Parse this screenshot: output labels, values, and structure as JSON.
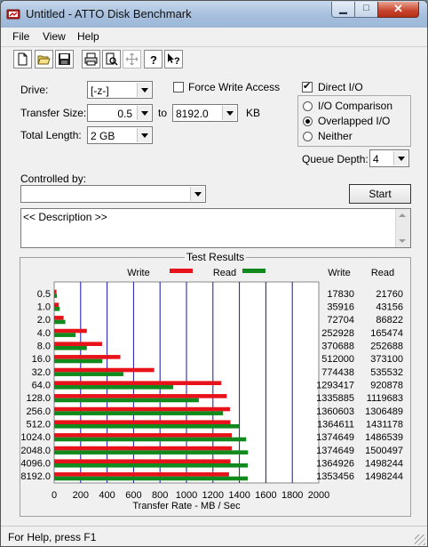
{
  "window": {
    "title": "Untitled - ATTO Disk Benchmark"
  },
  "menu": [
    "File",
    "View",
    "Help"
  ],
  "toolbar": [
    "new-file-icon",
    "open-folder-icon",
    "save-icon",
    "print-icon",
    "print-preview-icon",
    "move-icon",
    "help-icon",
    "context-help-icon"
  ],
  "form": {
    "drive_label": "Drive:",
    "drive_value": "[-z-]",
    "force_write_label": "Force Write Access",
    "force_write_checked": false,
    "direct_io_label": "Direct I/O",
    "direct_io_checked": true,
    "transfer_size_label": "Transfer Size:",
    "transfer_min": "0.5",
    "to_label": "to",
    "transfer_max": "8192.0",
    "kb_label": "KB",
    "total_length_label": "Total Length:",
    "total_length_value": "2 GB",
    "io_options": [
      "I/O Comparison",
      "Overlapped I/O",
      "Neither"
    ],
    "io_selected": "Overlapped I/O",
    "queue_depth_label": "Queue Depth:",
    "queue_depth_value": "4",
    "controlled_by_label": "Controlled by:",
    "controlled_by_value": "",
    "start_label": "Start",
    "description": "<< Description >>"
  },
  "results": {
    "title": "Test Results",
    "write_legend": "Write",
    "read_legend": "Read",
    "col_write": "Write",
    "col_read": "Read",
    "xlabel": "Transfer Rate - MB / Sec"
  },
  "chart_data": {
    "type": "bar",
    "orientation": "horizontal",
    "title": "Test Results",
    "xlabel": "Transfer Rate - MB / Sec",
    "xlim": [
      0,
      2000
    ],
    "xticks": [
      0,
      200,
      400,
      600,
      800,
      1000,
      1200,
      1400,
      1600,
      1800,
      2000
    ],
    "categories": [
      "0.5",
      "1.0",
      "2.0",
      "4.0",
      "8.0",
      "16.0",
      "32.0",
      "64.0",
      "128.0",
      "256.0",
      "512.0",
      "1024.0",
      "2048.0",
      "4096.0",
      "8192.0"
    ],
    "series": [
      {
        "name": "Write",
        "color": "#e8131a",
        "values": [
          17830,
          35916,
          72704,
          252928,
          370688,
          512000,
          774438,
          1293417,
          1335885,
          1360603,
          1364611,
          1374649,
          1374649,
          1364926,
          1353456
        ]
      },
      {
        "name": "Read",
        "color": "#108a1c",
        "values": [
          21760,
          43156,
          86822,
          165474,
          252688,
          373100,
          535532,
          920878,
          1119683,
          1306489,
          1431178,
          1486539,
          1500497,
          1498244,
          1498244
        ]
      }
    ],
    "grid": true,
    "legend": "top"
  },
  "colors": {
    "write": "#e8131a",
    "read": "#108a1c",
    "grid": "#1414b4"
  },
  "status": {
    "text": "For Help, press F1"
  }
}
